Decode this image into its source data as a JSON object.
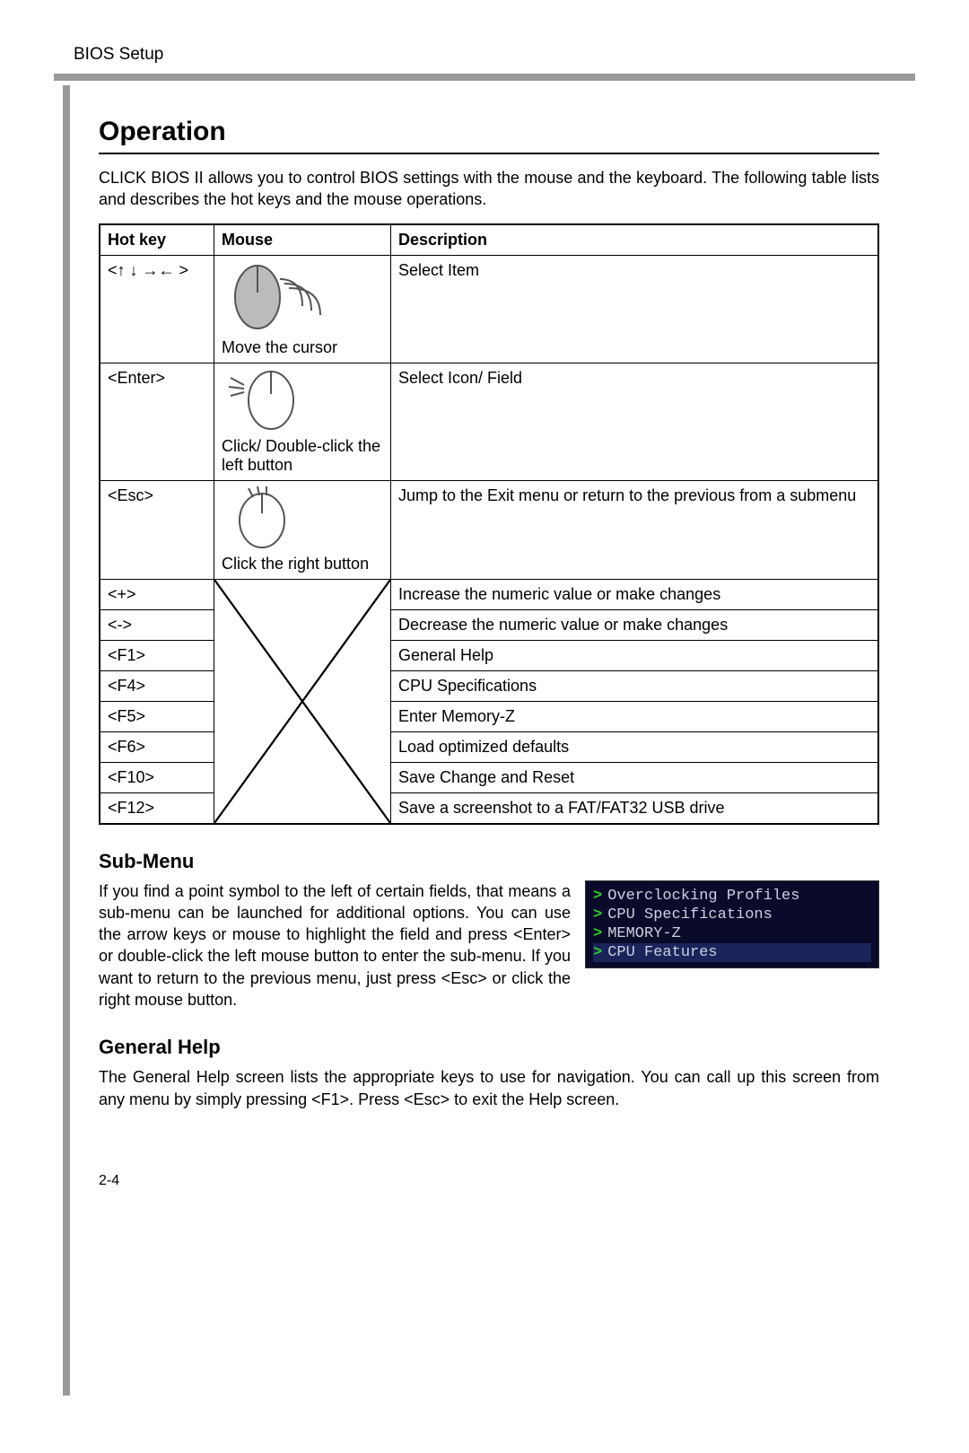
{
  "header": {
    "section_label": "BIOS Setup",
    "page_number": "2-4"
  },
  "title": "Operation",
  "intro": "CLICK BIOS II allows you to control BIOS settings with the mouse and the keyboard. The following table lists and describes the hot keys and the mouse operations.",
  "table": {
    "headers": {
      "hotkey": "Hot key",
      "mouse": "Mouse",
      "desc": "Description"
    },
    "rows_top": [
      {
        "hotkey": "<↑ ↓ →← >",
        "mouse_label": "Move the cursor",
        "desc": "Select Item",
        "icon": "move"
      },
      {
        "hotkey": "<Enter>",
        "mouse_label": "Click/ Double-click the left button",
        "desc": "Select  Icon/ Field",
        "icon": "left"
      },
      {
        "hotkey": "<Esc>",
        "mouse_label": "Click the right button",
        "desc": "Jump to the Exit menu or return to the previous from a submenu",
        "icon": "right"
      }
    ],
    "rows_bottom": [
      {
        "hotkey": "<+>",
        "desc": "Increase the numeric value or make changes"
      },
      {
        "hotkey": "<->",
        "desc": "Decrease the numeric value or make changes"
      },
      {
        "hotkey": "<F1>",
        "desc": "General Help"
      },
      {
        "hotkey": "<F4>",
        "desc": "CPU Specifications"
      },
      {
        "hotkey": "<F5>",
        "desc": "Enter Memory-Z"
      },
      {
        "hotkey": "<F6>",
        "desc": "Load optimized defaults"
      },
      {
        "hotkey": "<F10>",
        "desc": "Save Change and Reset"
      },
      {
        "hotkey": "<F12>",
        "desc": "Save a screenshot to a FAT/FAT32 USB drive"
      }
    ]
  },
  "submenu": {
    "heading": "Sub-Menu",
    "text": "If you find a point symbol to the left of certain fields, that means a sub-menu can be launched for additional options. You can use the arrow keys or mouse to highlight the field and press <Enter> or double-click the left mouse button to enter the sub-menu. If you want to return to the previous menu, just press <Esc> or click the right mouse button.",
    "items": [
      {
        "label": "Overclocking Profiles"
      },
      {
        "label": "CPU Specifications"
      },
      {
        "label": "MEMORY-Z"
      },
      {
        "label": "CPU Features"
      }
    ]
  },
  "general_help": {
    "heading": "General Help",
    "text": "The General Help screen lists the appropriate keys to use for navigation. You can call up this screen from any menu by simply pressing <F1>. Press <Esc> to exit the Help screen."
  }
}
